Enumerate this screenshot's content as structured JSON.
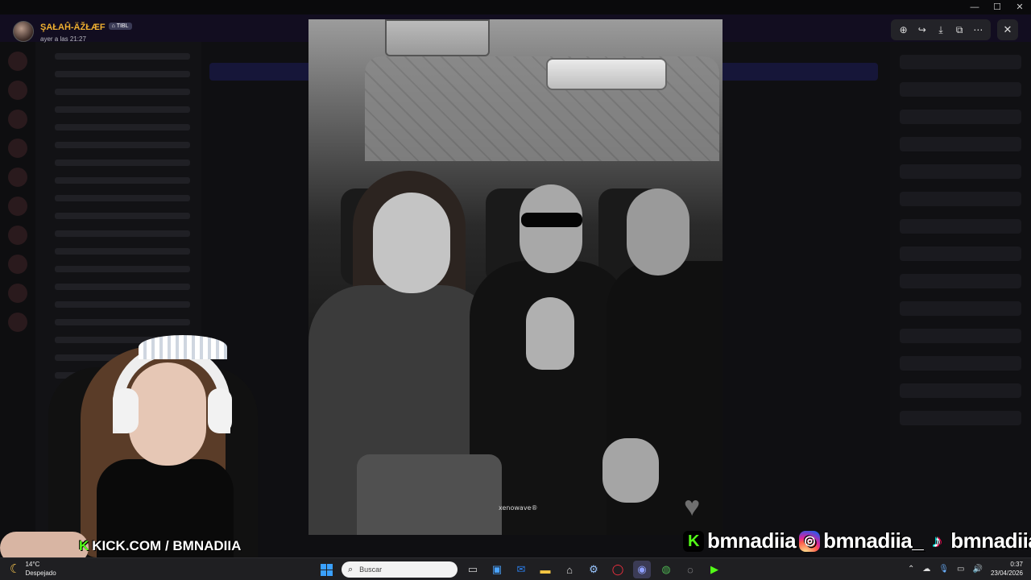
{
  "viewer": {
    "author_name": "ŞAŁAĤ-ÄŽŁÆF",
    "author_tag": "TIBL",
    "timestamp": "ayer a las 21:27",
    "tools": [
      "zoom-icon",
      "forward-icon",
      "download-icon",
      "open-external-icon",
      "more-icon"
    ],
    "close_icon": "close-icon"
  },
  "photo": {
    "watermark": "xenowave®",
    "overlay_icon": "heart-icon"
  },
  "stream": {
    "kick_label": "KICK.COM / BMNADIIA",
    "kick_accent": "#53fc18",
    "socials": [
      {
        "icon": "kick-icon",
        "handle": "bmnadiia"
      },
      {
        "icon": "instagram-icon",
        "handle": "bmnadiia_"
      },
      {
        "icon": "tiktok-icon",
        "handle": "bmnadiia"
      }
    ]
  },
  "taskbar": {
    "weather_temp": "14°C",
    "weather_desc": "Despejado",
    "search_placeholder": "Buscar",
    "time": "0:37",
    "date": "23/04/2026"
  }
}
